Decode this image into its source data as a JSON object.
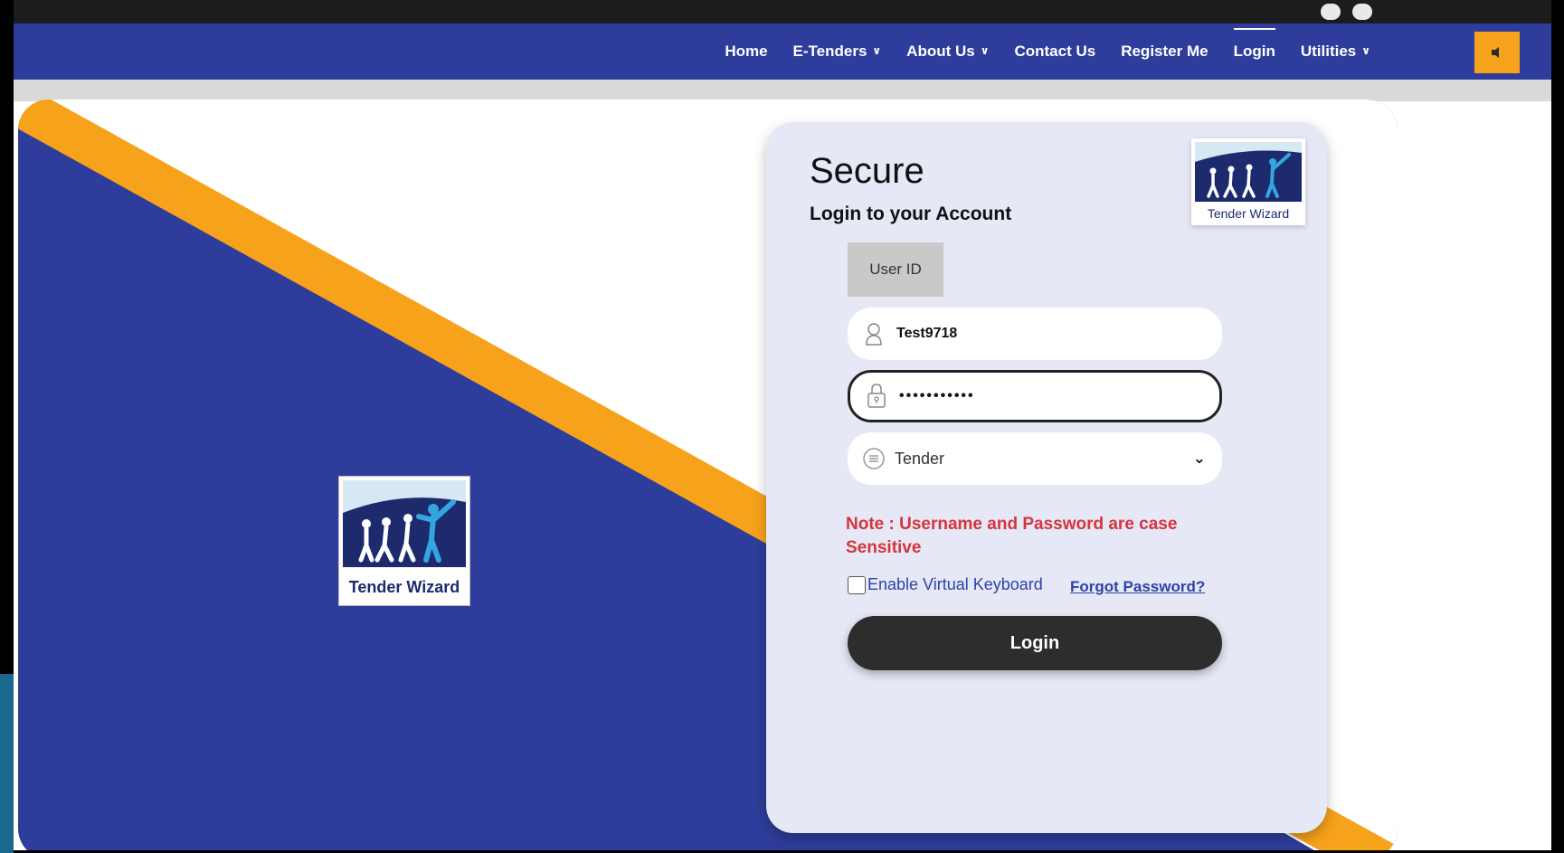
{
  "nav": {
    "items": [
      {
        "label": "Home",
        "dropdown": false
      },
      {
        "label": "E-Tenders",
        "dropdown": true
      },
      {
        "label": "About Us",
        "dropdown": true
      },
      {
        "label": "Contact Us",
        "dropdown": false
      },
      {
        "label": "Register Me",
        "dropdown": false
      },
      {
        "label": "Login",
        "dropdown": false,
        "active": true
      },
      {
        "label": "Utilities",
        "dropdown": true
      }
    ],
    "speaker_icon": "speaker-icon"
  },
  "brand": {
    "logo_text": "Tender Wizard"
  },
  "login_card": {
    "title": "Secure",
    "subtitle": "Login to your Account",
    "tab_label": "User ID",
    "username_value": "Test9718",
    "password_value": "•••••••••••",
    "role_selected": "Tender",
    "note": "Note : Username and Password are case Sensitive",
    "virtual_keyboard_label": "Enable Virtual Keyboard",
    "forgot_password": "Forgot Password?",
    "login_button": "Login"
  },
  "colors": {
    "nav_bg": "#2e3d9b",
    "accent_orange": "#f7a21b",
    "note_red": "#d6343d",
    "link_blue": "#2d42a8",
    "button_dark": "#2d2d2d"
  }
}
